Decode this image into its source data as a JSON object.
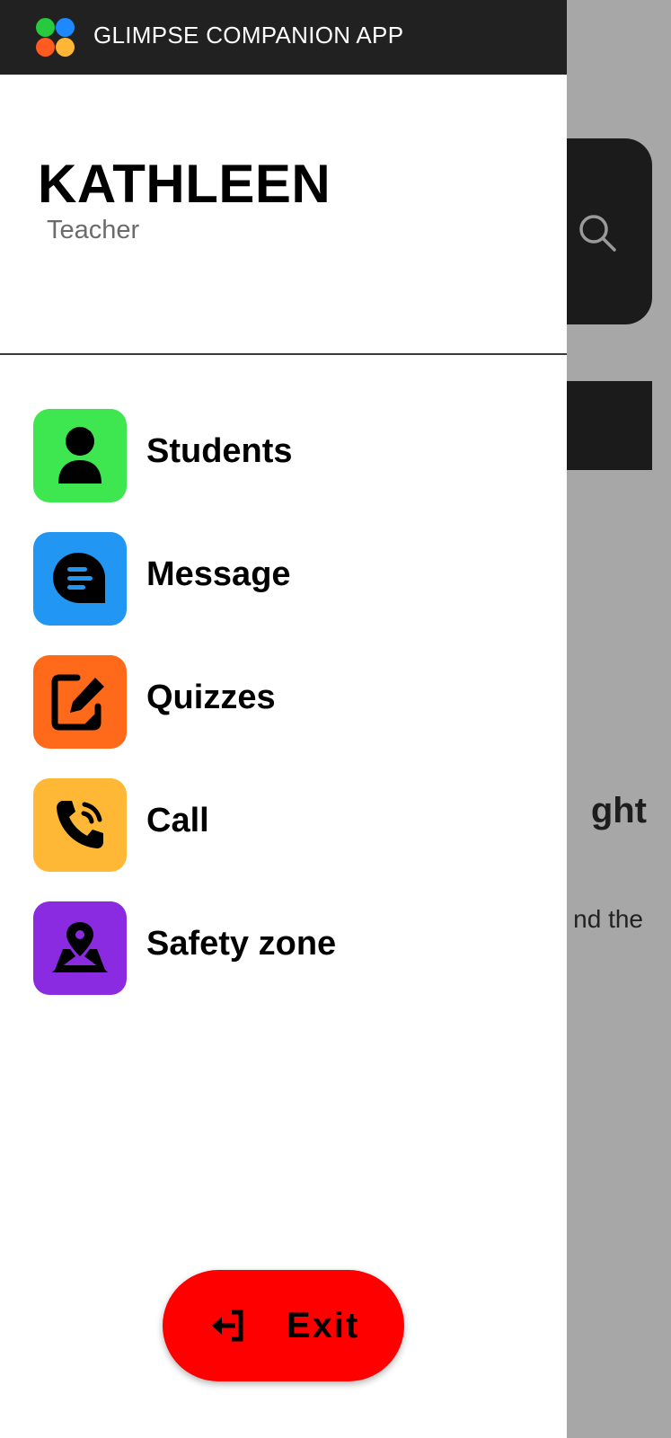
{
  "app": {
    "title": "GLIMPSE COMPANION APP",
    "logo_colors": [
      "#27c93f",
      "#1e88ff",
      "#ff5a1f",
      "#ffb636"
    ]
  },
  "profile": {
    "name": "KATHLEEN",
    "role": "Teacher"
  },
  "menu": {
    "items": [
      {
        "label": "Students",
        "icon": "person-icon",
        "color": "#3ee64f"
      },
      {
        "label": "Message",
        "icon": "message-icon",
        "color": "#2196f3"
      },
      {
        "label": "Quizzes",
        "icon": "edit-icon",
        "color": "#ff6a1a"
      },
      {
        "label": "Call",
        "icon": "phone-icon",
        "color": "#ffb836"
      },
      {
        "label": "Safety zone",
        "icon": "map-pin-icon",
        "color": "#8a2be2"
      }
    ]
  },
  "exit": {
    "label": "Exit",
    "icon": "logout-icon",
    "color": "#ff0000"
  },
  "background": {
    "heading_fragment": "ght",
    "text_fragment": "nd the",
    "search_icon": "search-icon"
  }
}
